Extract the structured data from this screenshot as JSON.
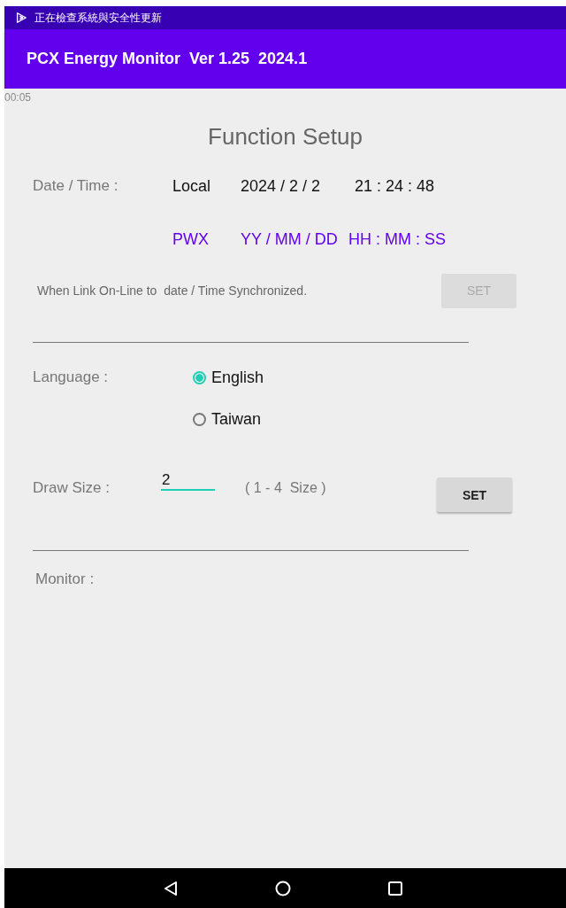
{
  "status_bar": {
    "notification": "正在檢查系統與安全性更新"
  },
  "app_bar": {
    "title": "PCX Energy Monitor  Ver 1.25  2024.1"
  },
  "overlay_timer": "00:05",
  "page_title": "Function Setup",
  "date_time": {
    "label": "Date / Time :",
    "source": "Local",
    "date": "2024 / 2 / 2",
    "time": "21 : 24 : 48"
  },
  "format_row": {
    "source": "PWX",
    "date": "YY / MM / DD",
    "time": "HH : MM : SS"
  },
  "sync": {
    "text": "When Link On-Line to  date / Time Synchronized.",
    "button": {
      "label": "SET",
      "disabled": true
    }
  },
  "language": {
    "label": "Language :",
    "options": [
      {
        "label": "English",
        "selected": true
      },
      {
        "label": "Taiwan",
        "selected": false
      }
    ]
  },
  "draw_size": {
    "label": "Draw Size :",
    "value": "2",
    "hint": "( 1 - 4  Size )",
    "button": {
      "label": "SET",
      "disabled": false
    }
  },
  "monitor": {
    "label": "Monitor :"
  }
}
